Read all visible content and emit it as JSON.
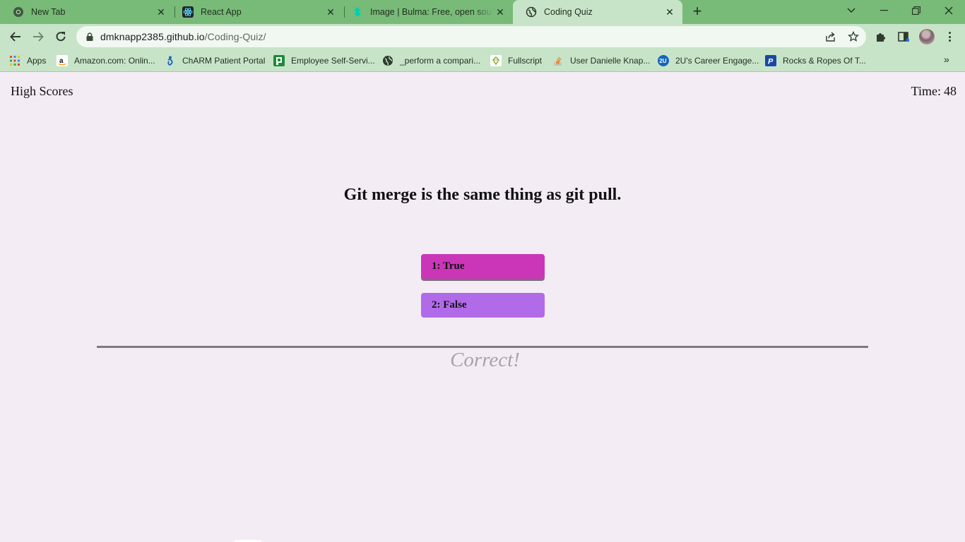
{
  "browser": {
    "tabs": [
      {
        "title": "New Tab",
        "icon": "chrome-icon",
        "active": false
      },
      {
        "title": "React App",
        "icon": "react-icon",
        "active": false
      },
      {
        "title": "Image | Bulma: Free, open source",
        "icon": "bulma-icon",
        "active": false
      },
      {
        "title": "Coding Quiz",
        "icon": "globe-icon",
        "active": true
      }
    ],
    "url_host": "dmknapp2385.github.io",
    "url_path": "/Coding-Quiz/",
    "bookmarks": [
      {
        "label": "Apps",
        "icon": "apps-grid-icon"
      },
      {
        "label": "Amazon.com: Onlin...",
        "icon": "amazon-icon"
      },
      {
        "label": "ChARM Patient Portal",
        "icon": "charm-icon"
      },
      {
        "label": "Employee Self-Servi...",
        "icon": "employee-icon"
      },
      {
        "label": "_perform a compari...",
        "icon": "globe-icon"
      },
      {
        "label": "Fullscript",
        "icon": "fullscript-icon"
      },
      {
        "label": "User Danielle Knap...",
        "icon": "stackoverflow-icon"
      },
      {
        "label": "2U's Career Engage...",
        "icon": "2u-icon"
      },
      {
        "label": "Rocks & Ropes Of T...",
        "icon": "p-icon"
      }
    ]
  },
  "quiz": {
    "high_scores_label": "High Scores",
    "timer_label": "Time:",
    "timer_value": "48",
    "question": "Git merge is the same thing as git pull.",
    "answers": [
      "1: True",
      "2: False"
    ],
    "feedback": "Correct!"
  },
  "colors": {
    "page_bg": "#f4ecf4",
    "answer_1_bg": "#cb36b9",
    "answer_2_bg": "#b16be9",
    "chrome_frame": "#78ba78",
    "chrome_toolbar": "#c8e4c8"
  }
}
